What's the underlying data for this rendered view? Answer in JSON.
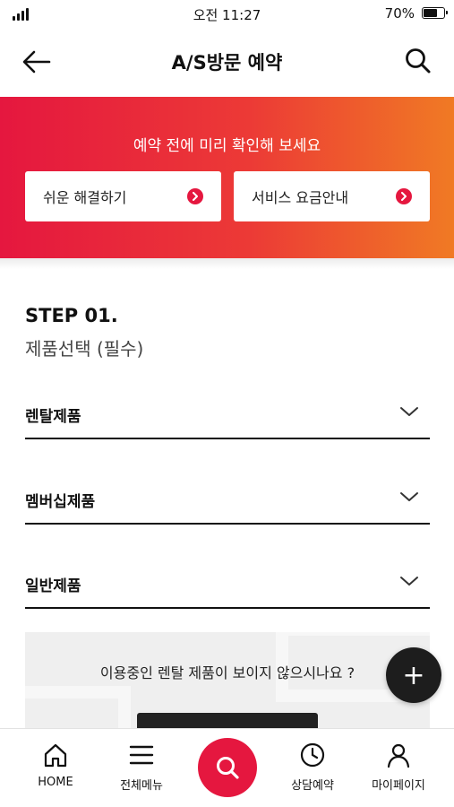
{
  "status_bar": {
    "time": "오전 11:27",
    "battery_percent": "70%"
  },
  "header": {
    "title": "A/S방문 예약"
  },
  "banner": {
    "title": "예약 전에 미리 확인해 보세요",
    "buttons": [
      {
        "label": "쉬운 해결하기"
      },
      {
        "label": "서비스 요금안내"
      }
    ]
  },
  "step": {
    "heading": "STEP 01.",
    "subheading": "제품선택 (필수)",
    "categories": [
      {
        "label": "렌탈제품"
      },
      {
        "label": "멤버십제품"
      },
      {
        "label": "일반제품"
      }
    ]
  },
  "notice": {
    "text": "이용중인 렌탈 제품이 보이지 않으시나요 ?"
  },
  "fab": {
    "label": "+"
  },
  "bottom_nav": {
    "items": [
      {
        "label": "HOME",
        "icon": "home-icon"
      },
      {
        "label": "전체메뉴",
        "icon": "menu-icon"
      },
      {
        "label": "",
        "icon": "search-icon"
      },
      {
        "label": "상담예약",
        "icon": "clock-icon"
      },
      {
        "label": "마이페이지",
        "icon": "person-icon"
      }
    ]
  },
  "colors": {
    "accent": "#e5173f",
    "gradient_end": "#f07a24",
    "dark": "#1d1d1d"
  }
}
